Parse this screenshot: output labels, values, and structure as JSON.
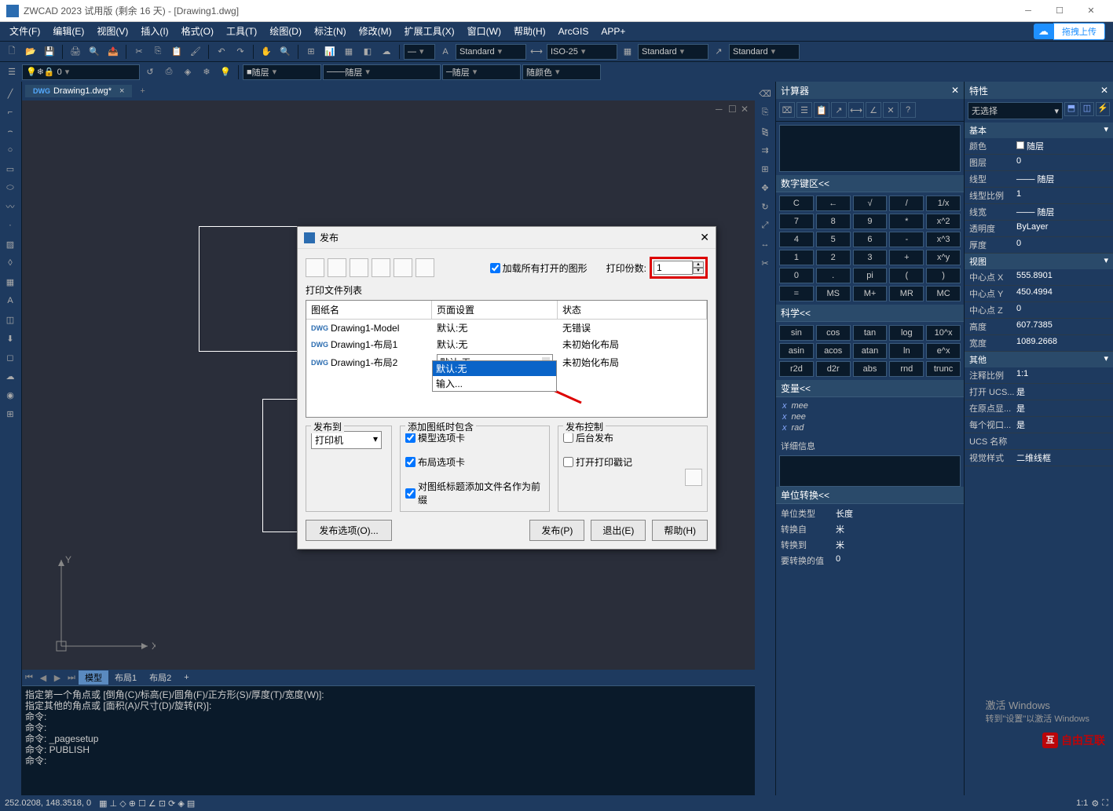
{
  "titlebar": {
    "text": "ZWCAD 2023 试用版 (剩余 16 天) - [Drawing1.dwg]"
  },
  "upload": {
    "button": "拖拽上传"
  },
  "menubar": [
    "文件(F)",
    "编辑(E)",
    "视图(V)",
    "插入(I)",
    "格式(O)",
    "工具(T)",
    "绘图(D)",
    "标注(N)",
    "修改(M)",
    "扩展工具(X)",
    "窗口(W)",
    "帮助(H)",
    "ArcGIS",
    "APP+"
  ],
  "toolbar2": {
    "layer_state": "随层",
    "style_text": "Standard",
    "dim_style": "ISO-25",
    "tbl_style": "Standard",
    "std2": "Standard",
    "col_follow": "随层",
    "lt_follow": "随层",
    "color_follow": "随颜色"
  },
  "doc_tab": {
    "name": "Drawing1.dwg*"
  },
  "bottom_tabs": {
    "model": "模型",
    "layout1": "布局1",
    "layout2": "布局2"
  },
  "cmdline": {
    "l1": "指定第一个角点或 [倒角(C)/标高(E)/圆角(F)/正方形(S)/厚度(T)/宽度(W)]:",
    "l2": "指定其他的角点或 [面积(A)/尺寸(D)/旋转(R)]:",
    "l3": "命令:",
    "l4": "命令:",
    "l5": "命令: _pagesetup",
    "l6": "命令: PUBLISH",
    "l7": "命令:"
  },
  "calc": {
    "title": "计算器",
    "numpad_label": "数字键区<<",
    "keys_r1": [
      "C",
      "←",
      "√",
      "/",
      "1/x"
    ],
    "keys_r2": [
      "7",
      "8",
      "9",
      "*",
      "x^2"
    ],
    "keys_r3": [
      "4",
      "5",
      "6",
      "-",
      "x^3"
    ],
    "keys_r4": [
      "1",
      "2",
      "3",
      "+",
      "x^y"
    ],
    "keys_r5": [
      "0",
      ".",
      "pi",
      "(",
      ")"
    ],
    "keys_r6": [
      "=",
      "MS",
      "M+",
      "MR",
      "MC"
    ],
    "sci_label": "科学<<",
    "sci_r1": [
      "sin",
      "cos",
      "tan",
      "log",
      "10^x"
    ],
    "sci_r2": [
      "asin",
      "acos",
      "atan",
      "ln",
      "e^x"
    ],
    "sci_r3": [
      "r2d",
      "d2r",
      "abs",
      "rnd",
      "trunc"
    ],
    "vars_label": "变量<<",
    "vars": [
      "mee",
      "nee",
      "rad"
    ],
    "detail": "详细信息",
    "unit_label": "单位转换<<",
    "unit_type_label": "单位类型",
    "unit_type_value": "长度",
    "from_label": "转换自",
    "from_value": "米",
    "to_label": "转换到",
    "to_value": "米",
    "to_conv_label": "要转换的值",
    "to_conv_value": "0"
  },
  "props": {
    "title": "特性",
    "selector": "无选择",
    "groups": {
      "basic": "基本",
      "view": "视图",
      "other": "其他"
    },
    "basic": {
      "color_label": "颜色",
      "color_value": "随层",
      "layer_label": "图层",
      "layer_value": "0",
      "ltype_label": "线型",
      "ltype_value": "随层",
      "lscale_label": "线型比例",
      "lscale_value": "1",
      "lweight_label": "线宽",
      "lweight_value": "随层",
      "trans_label": "透明度",
      "trans_value": "ByLayer",
      "thick_label": "厚度",
      "thick_value": "0"
    },
    "view": {
      "cx_label": "中心点 X",
      "cx_value": "555.8901",
      "cy_label": "中心点 Y",
      "cy_value": "450.4994",
      "cz_label": "中心点 Z",
      "cz_value": "0",
      "h_label": "高度",
      "h_value": "607.7385",
      "w_label": "宽度",
      "w_value": "1089.2668"
    },
    "other": {
      "ann_label": "注释比例",
      "ann_value": "1:1",
      "ucs_label": "打开 UCS...",
      "ucs_value": "是",
      "orig_label": "在原点显...",
      "orig_value": "是",
      "vp_label": "每个视口...",
      "vp_value": "是",
      "ucsn_label": "UCS 名称",
      "ucsn_value": "",
      "vs_label": "视觉样式",
      "vs_value": "二维线框"
    }
  },
  "dialog": {
    "title": "发布",
    "load_all": "加载所有打开的图形",
    "copies_label": "打印份数:",
    "copies_value": "1",
    "filelist_label": "打印文件列表",
    "cols": {
      "name": "图纸名",
      "page": "页面设置",
      "status": "状态"
    },
    "rows": [
      {
        "name": "Drawing1-Model",
        "page": "默认:无",
        "status": "无错误"
      },
      {
        "name": "Drawing1-布局1",
        "page": "默认:无",
        "status": "未初始化布局"
      },
      {
        "name": "Drawing1-布局2",
        "page": "默认:无",
        "status": "未初始化布局"
      }
    ],
    "dd_options": {
      "opt1": "默认:无",
      "opt2": "输入..."
    },
    "publish_to": {
      "title": "发布到",
      "value": "打印机"
    },
    "include": {
      "title": "添加图纸时包含",
      "model_tab": "模型选项卡",
      "layout_tab": "布局选项卡",
      "prefix": "对图纸标题添加文件名作为前缀"
    },
    "control": {
      "title": "发布控制",
      "background": "后台发布",
      "stamp": "打开打印戳记"
    },
    "buttons": {
      "options": "发布选项(O)...",
      "publish": "发布(P)",
      "exit": "退出(E)",
      "help": "帮助(H)"
    }
  },
  "statusbar": {
    "coords": "252.0208, 148.3518, 0",
    "scale": "1:1"
  },
  "watermark": {
    "line1": "激活 Windows",
    "line2": "转到\"设置\"以激活 Windows"
  },
  "site_watermark": "自由互联"
}
